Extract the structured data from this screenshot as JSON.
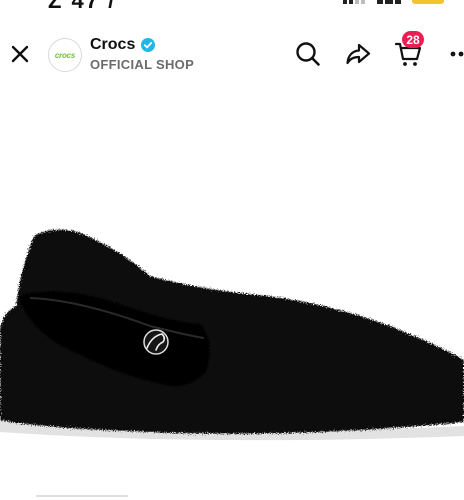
{
  "header": {
    "shop_logo_text": "crocs",
    "shop_name": "Crocs",
    "shop_subtitle": "OFFICIAL SHOP",
    "cart_count": "28"
  },
  "icons": {
    "close": "close-icon",
    "verified": "verified-check-icon",
    "search": "search-icon",
    "share": "share-icon",
    "cart": "cart-icon",
    "more": "more-options-icon"
  },
  "colors": {
    "badge": "#ee1d52",
    "verified": "#20b7e8",
    "logo": "#6fbf3f",
    "product": "#0d0d0d"
  }
}
